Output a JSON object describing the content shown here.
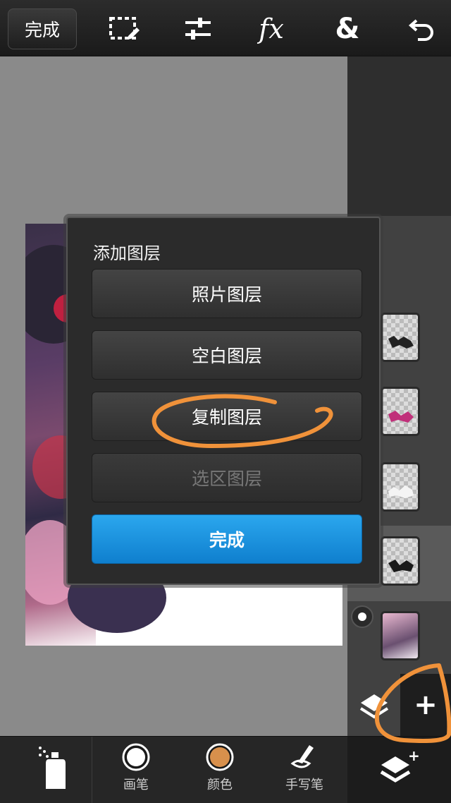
{
  "topbar": {
    "done_label": "完成",
    "icons": [
      "selection-icon",
      "adjust-icon",
      "fx-icon",
      "blend-icon",
      "undo-icon"
    ],
    "fx_text": "fx",
    "blend_text": "&"
  },
  "dialog": {
    "title": "添加图层",
    "buttons": {
      "photo_layer": "照片图层",
      "blank_layer": "空白图层",
      "duplicate_layer": "复制图层",
      "selection_layer": "选区图层",
      "done": "完成"
    }
  },
  "layers": {
    "add_label": "+",
    "count": 5
  },
  "bottombar": {
    "brush_label": "画笔",
    "color_label": "颜色",
    "pen_label": "手写笔",
    "brush_color": "#ffffff",
    "current_color": "#d8904c"
  },
  "colors": {
    "primary_button": "#1b8fde",
    "annotation": "#f0923a"
  }
}
